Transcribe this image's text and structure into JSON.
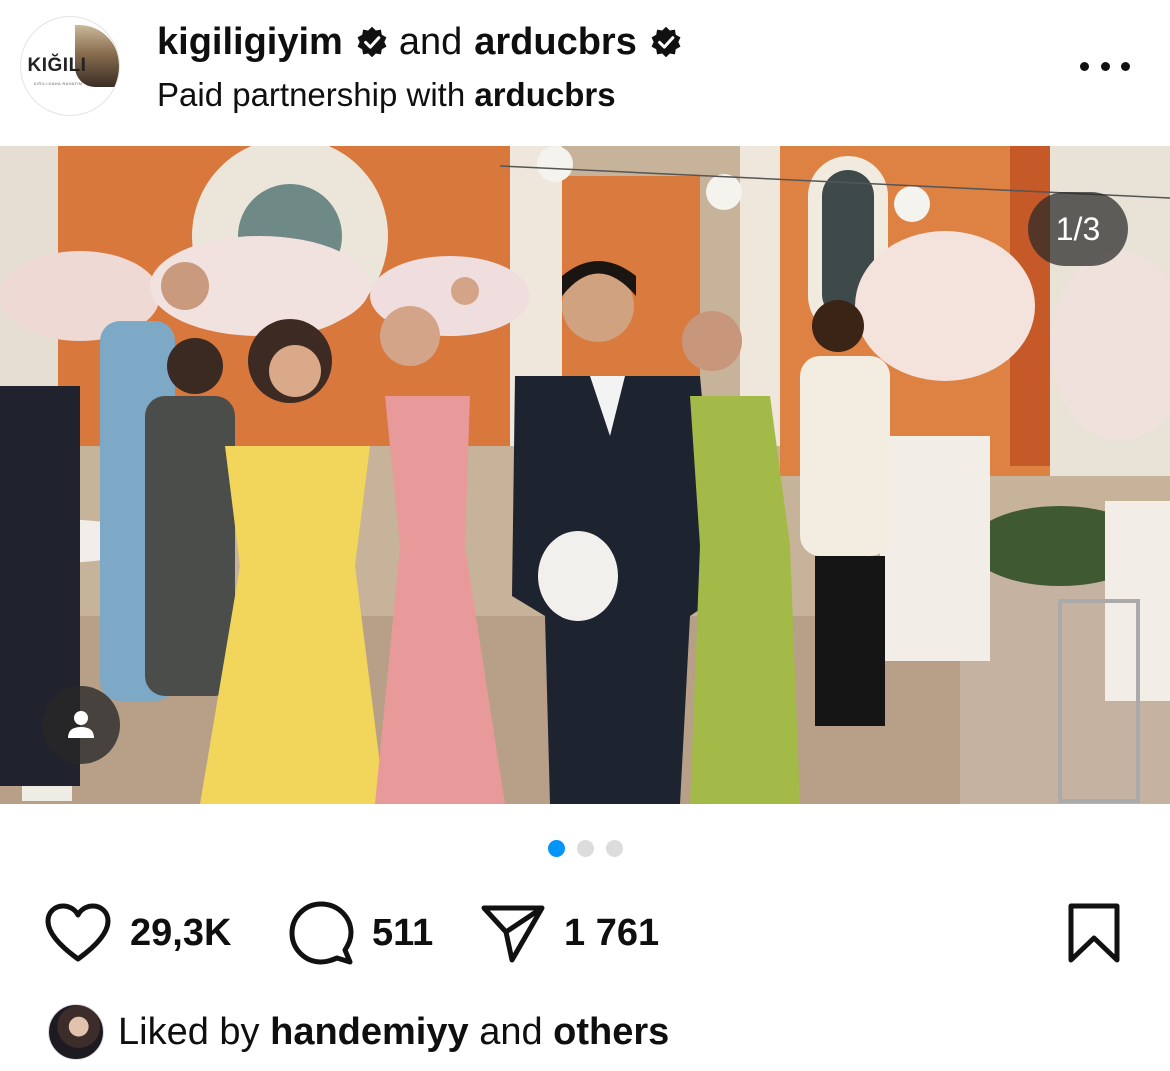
{
  "post": {
    "author1": "kigiligiyim",
    "connector": "and",
    "author2": "arducbrs",
    "partnership_prefix": "Paid partnership with",
    "partnership_partner": "arducbrs",
    "avatar_brand": "KIĞILI",
    "avatar_tagline": "KIĞILI·DAHA·RAHATIM",
    "verified_icon": "verified-badge-icon",
    "more_icon": "more-options-icon"
  },
  "media": {
    "counter": "1/3",
    "current_slide": 1,
    "total_slides": 3,
    "tag_icon": "person-tag-icon"
  },
  "actions": {
    "like_count": "29,3K",
    "comment_count": "511",
    "share_count": "1 761",
    "like_icon": "heart-icon",
    "comment_icon": "comment-bubble-icon",
    "share_icon": "paper-plane-icon",
    "save_icon": "bookmark-icon"
  },
  "liked_by": {
    "prefix": "Liked by",
    "user": "handemiyy",
    "connector": "and",
    "others": "others"
  },
  "colors": {
    "accent_dot": "#0095f6",
    "inactive_dot": "#dcdcdc",
    "text": "#0f0f0f"
  }
}
